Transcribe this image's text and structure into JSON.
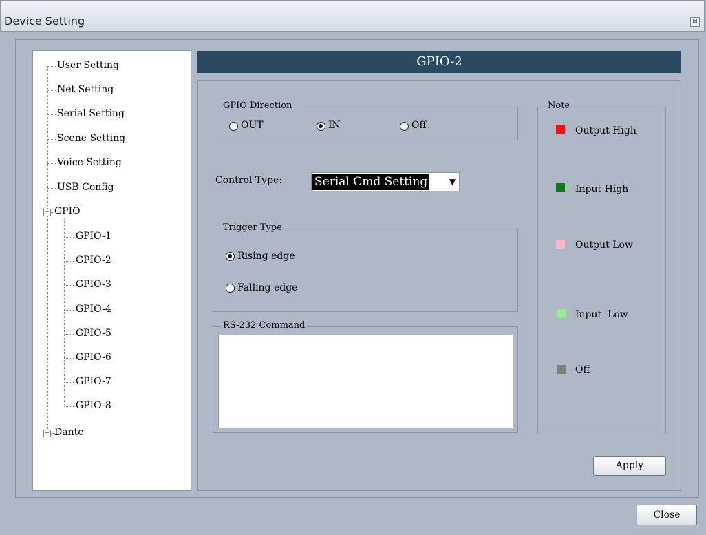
{
  "window": {
    "title": "Device Setting",
    "close_glyph": "⊠"
  },
  "tree": {
    "items": [
      {
        "label": "User Setting"
      },
      {
        "label": "Net Setting"
      },
      {
        "label": "Serial Setting"
      },
      {
        "label": "Scene Setting"
      },
      {
        "label": "Voice Setting"
      },
      {
        "label": "USB Config"
      },
      {
        "label": "GPIO",
        "expander": "−"
      },
      {
        "label": "GPIO-1"
      },
      {
        "label": "GPIO-2"
      },
      {
        "label": "GPIO-3"
      },
      {
        "label": "GPIO-4"
      },
      {
        "label": "GPIO-5"
      },
      {
        "label": "GPIO-6"
      },
      {
        "label": "GPIO-7"
      },
      {
        "label": "GPIO-8"
      },
      {
        "label": "Dante",
        "expander": "+"
      }
    ]
  },
  "header": {
    "title": "GPIO-2"
  },
  "direction": {
    "legend": "GPIO Direction",
    "options": [
      "OUT",
      "IN",
      "Off"
    ],
    "selected": "IN"
  },
  "control": {
    "label": "Control Type:",
    "value": "Serial Cmd Setting"
  },
  "trigger": {
    "legend": "Trigger Type",
    "options": [
      "Rising edge",
      "Falling edge"
    ],
    "selected": "Rising edge"
  },
  "command": {
    "legend": "RS-232 Command",
    "value": ""
  },
  "note": {
    "legend": "Note",
    "items": [
      {
        "label": "Output High",
        "color": "#ff1010"
      },
      {
        "label": "Input High",
        "color": "#0a7a14"
      },
      {
        "label": "Output Low",
        "color": "#ffb6c6"
      },
      {
        "label": "Input  Low",
        "color": "#90ee90"
      },
      {
        "label": "Off",
        "color": "#7f7f7f"
      }
    ]
  },
  "buttons": {
    "apply": "Apply",
    "close": "Close"
  },
  "colors": {
    "header_bg": "#2a4a62",
    "window_bg": "#aeb8c6"
  }
}
